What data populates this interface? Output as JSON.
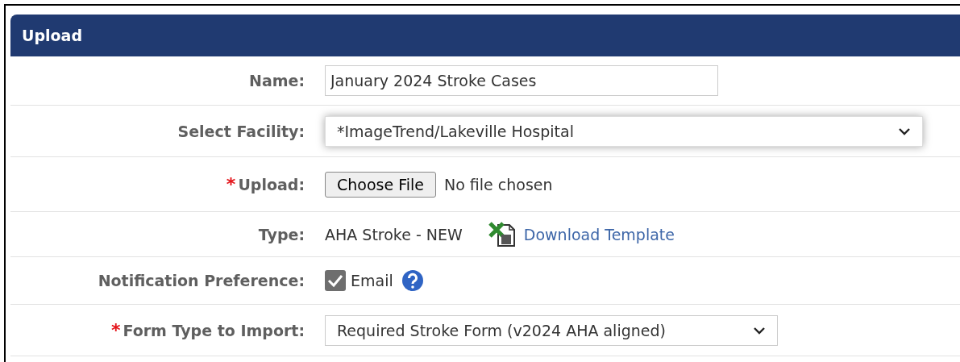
{
  "panel": {
    "title": "Upload"
  },
  "rows": [
    {
      "kind": "text",
      "label": "Name:",
      "value": "January 2024 Stroke Cases"
    },
    {
      "kind": "select",
      "label": "Select Facility:",
      "value": "*ImageTrend/Lakeville Hospital",
      "focused": true
    },
    {
      "kind": "file",
      "required_mark": "*",
      "label": "Upload:",
      "button": "Choose File",
      "status": "No file chosen"
    },
    {
      "kind": "type",
      "label": "Type:",
      "value": "AHA Stroke - NEW",
      "link": "Download Template"
    },
    {
      "kind": "checkbox",
      "label": "Notification Preference:",
      "option": "Email",
      "checked": true
    },
    {
      "kind": "select",
      "required_mark": "*",
      "label": "Form Type to Import:",
      "value": "Required Stroke Form (v2024 AHA aligned)",
      "focused": false
    }
  ]
}
